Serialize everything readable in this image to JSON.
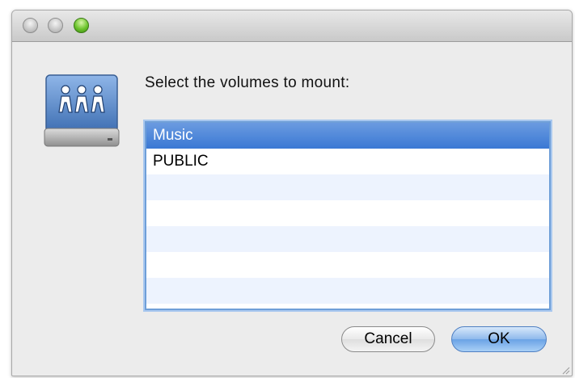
{
  "dialog": {
    "prompt": "Select the volumes to mount:",
    "volumes": [
      {
        "label": "Music",
        "selected": true
      },
      {
        "label": "PUBLIC",
        "selected": false
      },
      {
        "label": "",
        "selected": false
      },
      {
        "label": "",
        "selected": false
      },
      {
        "label": "",
        "selected": false
      },
      {
        "label": "",
        "selected": false
      },
      {
        "label": "",
        "selected": false
      }
    ],
    "cancel_label": "Cancel",
    "ok_label": "OK"
  },
  "icons": {
    "drive": "network-share-drive-icon",
    "close": "close-button-icon",
    "minimize": "minimize-button-icon",
    "zoom": "zoom-button-icon"
  },
  "colors": {
    "selection": "#3a78d4",
    "default_button": "#6aa2e5",
    "list_border": "#6f9fd8",
    "zoom_green": "#6cc42c"
  }
}
